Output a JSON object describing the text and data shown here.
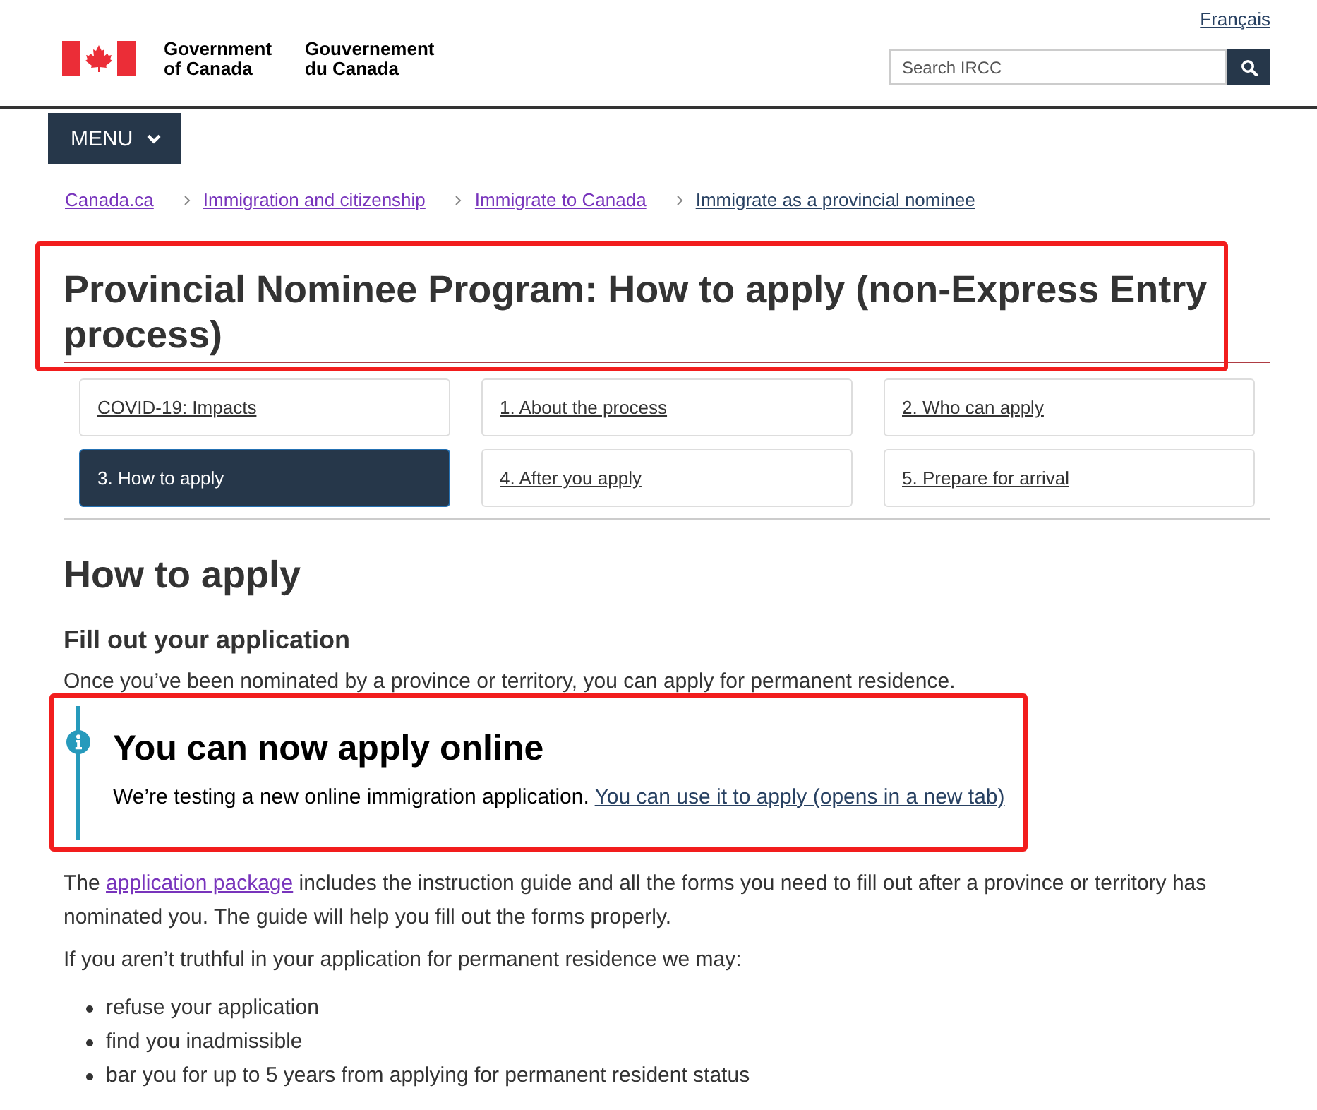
{
  "header": {
    "language_link": "Français",
    "wordmark_en": [
      "Government",
      "of Canada"
    ],
    "wordmark_fr": [
      "Gouvernement",
      "du Canada"
    ],
    "search": {
      "placeholder": "Search IRCC"
    }
  },
  "menu_button": "MENU",
  "breadcrumb": [
    {
      "label": "Canada.ca",
      "visited": true
    },
    {
      "label": "Immigration and citizenship",
      "visited": true
    },
    {
      "label": "Immigrate to Canada",
      "visited": true
    },
    {
      "label": "Immigrate as a provincial nominee",
      "visited": false
    }
  ],
  "title": {
    "text": "Provincial Nominee Program: How to apply (non-Express Entry process)",
    "highlighted": true
  },
  "page_nav": [
    {
      "label": "COVID-19: Impacts",
      "selected": false
    },
    {
      "label": "1. About the process",
      "selected": false
    },
    {
      "label": "2. Who can apply",
      "selected": false
    },
    {
      "label": "3. How to apply",
      "selected": true
    },
    {
      "label": "4. After you apply",
      "selected": false
    },
    {
      "label": "5. Prepare for arrival",
      "selected": false
    }
  ],
  "section_heading": "How to apply",
  "subheading": "Fill out your application",
  "intro": "Once you’ve been nominated by a province or territory, you can apply for permanent residence.",
  "notice": {
    "kind": "info",
    "highlighted": true,
    "heading": "You can now apply online",
    "text": "We’re testing a new online immigration application.",
    "link": "You can use it to apply (opens in a new tab)"
  },
  "package_paragraph": {
    "before": "The ",
    "link": "application package",
    "visited": true,
    "after": " includes the instruction guide and all the forms you need to fill out after a province or territory has nominated you. The guide will help you fill out the forms properly."
  },
  "warning_intro": "If you aren’t truthful in your application for permanent residence we may:",
  "consequences": [
    "refuse your application",
    "find you inadmissible",
    "bar you for up to 5 years from applying for permanent resident status"
  ]
}
